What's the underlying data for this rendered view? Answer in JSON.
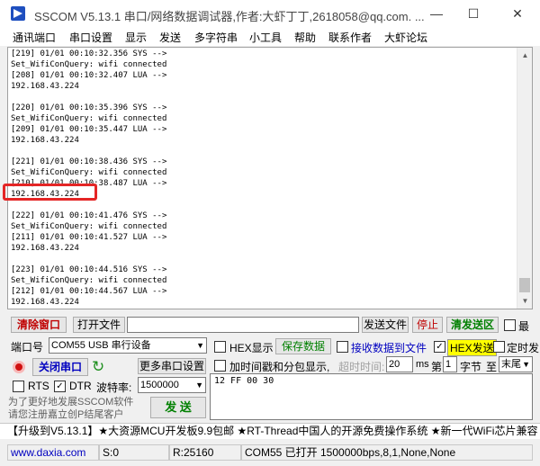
{
  "window": {
    "title": "SSCOM V5.13.1 串口/网络数据调试器,作者:大虾丁丁,2618058@qq.com. ...",
    "minimize": "—",
    "maximize": "☐",
    "close": "✕"
  },
  "menu": [
    "通讯端口",
    "串口设置",
    "显示",
    "发送",
    "多字符串",
    "小工具",
    "帮助",
    "联系作者",
    "大虾论坛"
  ],
  "log": {
    "lines": [
      "[219] 01/01 00:10:32.356 SYS -->",
      "Set_WifiConQuery: wifi connected",
      "[208] 01/01 00:10:32.407 LUA -->",
      "192.168.43.224",
      "",
      "[220] 01/01 00:10:35.396 SYS -->",
      "Set_WifiConQuery: wifi connected",
      "[209] 01/01 00:10:35.447 LUA -->",
      "192.168.43.224",
      "",
      "[221] 01/01 00:10:38.436 SYS -->",
      "Set_WifiConQuery: wifi connected",
      "[210] 01/01 00:10:38.487 LUA -->",
      "192.168.43.224",
      "",
      "[222] 01/01 00:10:41.476 SYS -->",
      "Set_WifiConQuery: wifi connected",
      "[211] 01/01 00:10:41.527 LUA -->",
      "192.168.43.224",
      "",
      "[223] 01/01 00:10:44.516 SYS -->",
      "Set_WifiConQuery: wifi connected",
      "[212] 01/01 00:10:44.567 LUA -->",
      "192.168.43.224"
    ],
    "highlight_color": "#e42525"
  },
  "toolbar1": {
    "clear_window": "清除窗口",
    "open_file": "打开文件",
    "file_path": "",
    "send_file": "发送文件",
    "stop": "停止",
    "clear_send": "清发送区",
    "last": "最"
  },
  "port": {
    "label": "端口号",
    "value": "COM55 USB 串行设备",
    "close_port": "关闭串口",
    "rts": "RTS",
    "dtr": "DTR",
    "rts_checked": false,
    "dtr_checked": true,
    "more_settings": "更多串口设置",
    "baud_label": "波特率:",
    "baud_value": "1500000"
  },
  "options": {
    "hex_display": "HEX显示",
    "save_data": "保存数据",
    "recv_to_file": "接收数据到文件",
    "hex_send": "HEX发送",
    "hex_send_checked": true,
    "timed_send": "定时发",
    "timestamp": "加时间戳和分包显示,",
    "timeout_label": "超时时间:",
    "timeout_value": "20",
    "ms": "ms",
    "nth": "第",
    "nth_value": "1",
    "bytes": "字节",
    "to": "至",
    "tail": "末尾"
  },
  "send": {
    "input_value": "12 FF 00 30",
    "button": "发 送"
  },
  "promo": {
    "line1": "为了更好地发展SSCOM软件",
    "line2": "请您注册嘉立创P结尾客户"
  },
  "ticker": "【升级到V5.13.1】★大资源MCU开发板9.9包邮 ★RT-Thread中国人的开源免费操作系统 ★新一代WiFi芯片兼容",
  "status": {
    "website": "www.daxia.com",
    "sent": "S:0",
    "received": "R:25160",
    "port_status": "COM55 已打开  1500000bps,8,1,None,None"
  }
}
